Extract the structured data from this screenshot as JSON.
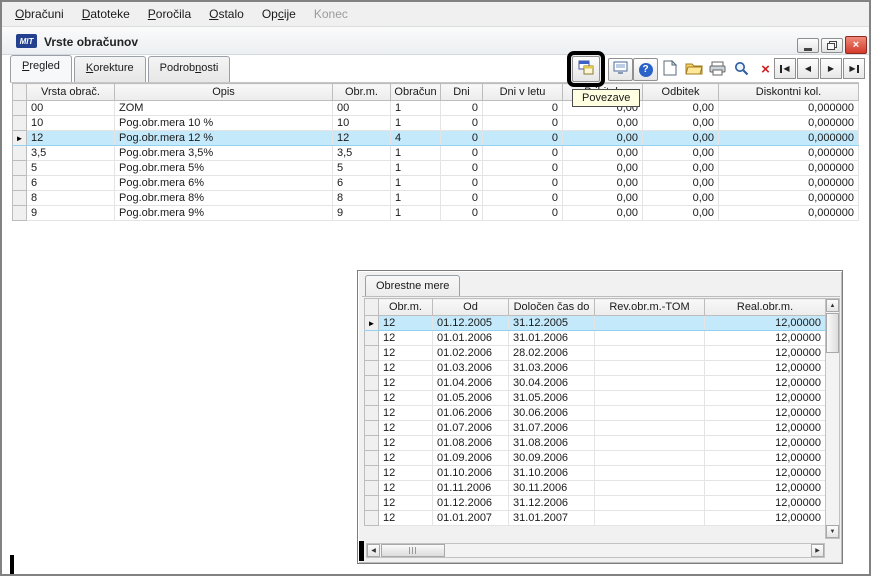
{
  "menu": {
    "items": [
      {
        "pre": "",
        "u": "O",
        "post": "bračuni",
        "disabled": false
      },
      {
        "pre": "",
        "u": "D",
        "post": "atoteke",
        "disabled": false
      },
      {
        "pre": "",
        "u": "P",
        "post": "oročila",
        "disabled": false
      },
      {
        "pre": "",
        "u": "O",
        "post": "stalo",
        "disabled": false
      },
      {
        "pre": "Op",
        "u": "c",
        "post": "ije",
        "disabled": false
      },
      {
        "pre": "Konec",
        "u": "",
        "post": "",
        "disabled": true
      }
    ]
  },
  "window": {
    "logo": "MIT",
    "title": "Vrste obračunov"
  },
  "tabs": [
    {
      "pre": "",
      "u": "P",
      "post": "regled",
      "active": true
    },
    {
      "pre": "",
      "u": "K",
      "post": "orekture",
      "active": false
    },
    {
      "pre": "Podrob",
      "u": "n",
      "post": "osti",
      "active": false
    }
  ],
  "toolbar": {
    "tooltip": "Povezave",
    "help_label": "?"
  },
  "glyphs": {
    "up": "▲",
    "down": "▼",
    "left": "◀",
    "right": "▶",
    "close": "×",
    "delete": "×",
    "marker": "►"
  },
  "main_table": {
    "columns": [
      "Vrsta obrač.",
      "Opis",
      "Obr.m.",
      "Obračun",
      "Dni",
      "Dni v letu",
      "Pribitek",
      "Odbitek",
      "Diskontni kol."
    ],
    "rows": [
      {
        "selected": false,
        "cells": [
          "00",
          "ZOM",
          "00",
          "1",
          "0",
          "0",
          "0,00",
          "0,00",
          "0,000000"
        ]
      },
      {
        "selected": false,
        "cells": [
          "10",
          "Pog.obr.mera 10 %",
          "10",
          "1",
          "0",
          "0",
          "0,00",
          "0,00",
          "0,000000"
        ]
      },
      {
        "selected": true,
        "cells": [
          "12",
          "Pog.obr.mera 12 %",
          "12",
          "4",
          "0",
          "0",
          "0,00",
          "0,00",
          "0,000000"
        ]
      },
      {
        "selected": false,
        "cells": [
          "3,5",
          "Pog.obr.mera 3,5%",
          "3,5",
          "1",
          "0",
          "0",
          "0,00",
          "0,00",
          "0,000000"
        ]
      },
      {
        "selected": false,
        "cells": [
          "5",
          "Pog.obr.mera 5%",
          "5",
          "1",
          "0",
          "0",
          "0,00",
          "0,00",
          "0,000000"
        ]
      },
      {
        "selected": false,
        "cells": [
          "6",
          "Pog.obr.mera 6%",
          "6",
          "1",
          "0",
          "0",
          "0,00",
          "0,00",
          "0,000000"
        ]
      },
      {
        "selected": false,
        "cells": [
          "8",
          "Pog.obr.mera 8%",
          "8",
          "1",
          "0",
          "0",
          "0,00",
          "0,00",
          "0,000000"
        ]
      },
      {
        "selected": false,
        "cells": [
          "9",
          "Pog.obr.mera 9%",
          "9",
          "1",
          "0",
          "0",
          "0,00",
          "0,00",
          "0,000000"
        ]
      }
    ]
  },
  "popup": {
    "tab": "Obrestne mere",
    "table": {
      "columns": [
        "Obr.m.",
        "Od",
        "Določen čas do",
        "Rev.obr.m.-TOM",
        "Real.obr.m."
      ],
      "rows": [
        {
          "selected": true,
          "cells": [
            "12",
            "01.12.2005",
            "31.12.2005",
            "",
            "12,00000"
          ]
        },
        {
          "selected": false,
          "cells": [
            "12",
            "01.01.2006",
            "31.01.2006",
            "",
            "12,00000"
          ]
        },
        {
          "selected": false,
          "cells": [
            "12",
            "01.02.2006",
            "28.02.2006",
            "",
            "12,00000"
          ]
        },
        {
          "selected": false,
          "cells": [
            "12",
            "01.03.2006",
            "31.03.2006",
            "",
            "12,00000"
          ]
        },
        {
          "selected": false,
          "cells": [
            "12",
            "01.04.2006",
            "30.04.2006",
            "",
            "12,00000"
          ]
        },
        {
          "selected": false,
          "cells": [
            "12",
            "01.05.2006",
            "31.05.2006",
            "",
            "12,00000"
          ]
        },
        {
          "selected": false,
          "cells": [
            "12",
            "01.06.2006",
            "30.06.2006",
            "",
            "12,00000"
          ]
        },
        {
          "selected": false,
          "cells": [
            "12",
            "01.07.2006",
            "31.07.2006",
            "",
            "12,00000"
          ]
        },
        {
          "selected": false,
          "cells": [
            "12",
            "01.08.2006",
            "31.08.2006",
            "",
            "12,00000"
          ]
        },
        {
          "selected": false,
          "cells": [
            "12",
            "01.09.2006",
            "30.09.2006",
            "",
            "12,00000"
          ]
        },
        {
          "selected": false,
          "cells": [
            "12",
            "01.10.2006",
            "31.10.2006",
            "",
            "12,00000"
          ]
        },
        {
          "selected": false,
          "cells": [
            "12",
            "01.11.2006",
            "30.11.2006",
            "",
            "12,00000"
          ]
        },
        {
          "selected": false,
          "cells": [
            "12",
            "01.12.2006",
            "31.12.2006",
            "",
            "12,00000"
          ]
        },
        {
          "selected": false,
          "cells": [
            "12",
            "01.01.2007",
            "31.01.2007",
            "",
            "12,00000"
          ]
        }
      ]
    }
  }
}
